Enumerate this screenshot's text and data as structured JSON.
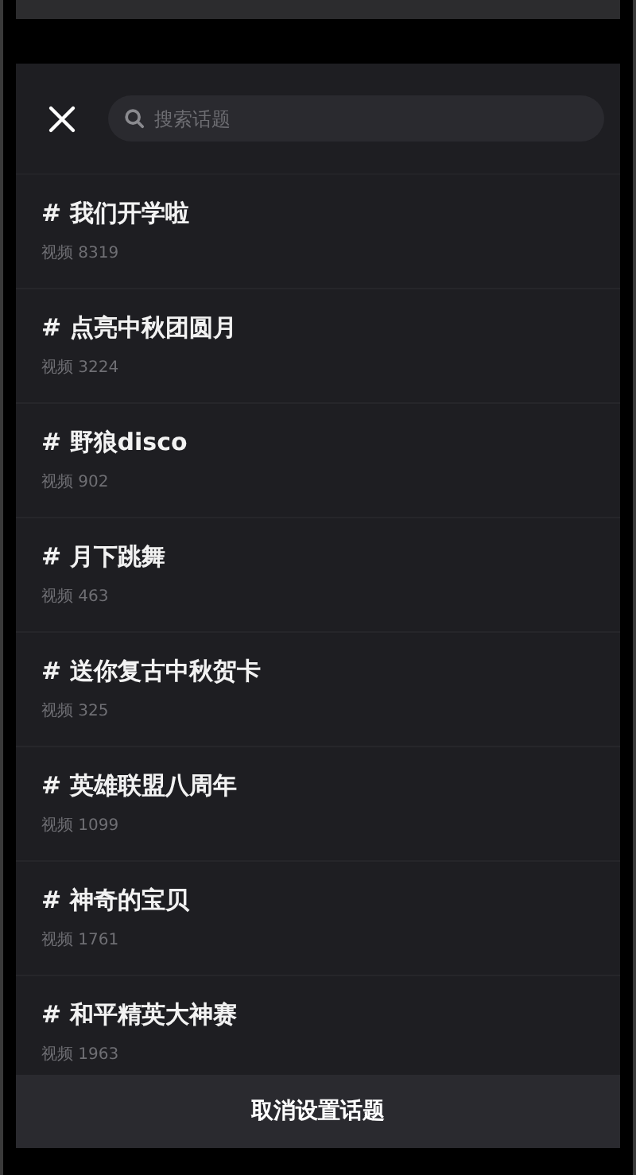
{
  "search": {
    "placeholder": "搜索话题"
  },
  "topics": [
    {
      "title": "# 我们开学啦",
      "count": "视频 8319"
    },
    {
      "title": "# 点亮中秋团圆月",
      "count": "视频 3224"
    },
    {
      "title": "# 野狼disco",
      "count": "视频 902"
    },
    {
      "title": "# 月下跳舞",
      "count": "视频 463"
    },
    {
      "title": "# 送你复古中秋贺卡",
      "count": "视频 325"
    },
    {
      "title": "# 英雄联盟八周年",
      "count": "视频 1099"
    },
    {
      "title": "# 神奇的宝贝",
      "count": "视频 1761"
    },
    {
      "title": "# 和平精英大神赛",
      "count": "视频 1963"
    }
  ],
  "footer_button": "取消设置话题"
}
